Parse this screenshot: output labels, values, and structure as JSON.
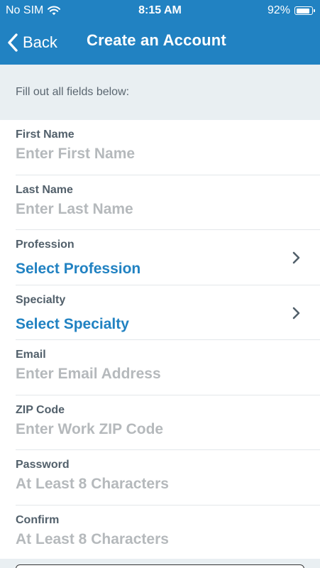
{
  "status_bar": {
    "carrier": "No SIM",
    "time": "8:15 AM",
    "battery_percent": "92%",
    "battery_level": 0.92,
    "wifi_icon": "wifi-icon",
    "battery_icon": "battery-icon"
  },
  "nav": {
    "back_label": "Back",
    "back_icon": "chevron-left-icon",
    "title": "Create an Account"
  },
  "instructions": "Fill out all fields below:",
  "fields": {
    "first_name": {
      "label": "First Name",
      "placeholder": "Enter First Name",
      "value": ""
    },
    "last_name": {
      "label": "Last Name",
      "placeholder": "Enter Last Name",
      "value": ""
    },
    "profession": {
      "label": "Profession",
      "value": "Select Profession",
      "icon": "chevron-right-icon"
    },
    "specialty": {
      "label": "Specialty",
      "value": "Select Specialty",
      "icon": "chevron-right-icon"
    },
    "email": {
      "label": "Email",
      "placeholder": "Enter Email Address",
      "value": ""
    },
    "zip_code": {
      "label": "ZIP Code",
      "placeholder": "Enter Work ZIP Code",
      "value": ""
    },
    "password": {
      "label": "Password",
      "placeholder": "At Least 8 Characters",
      "value": ""
    },
    "confirm": {
      "label": "Confirm",
      "placeholder": "At Least 8 Characters",
      "value": ""
    }
  },
  "colors": {
    "header_blue": "#2182c2",
    "accent_blue": "#2182c2",
    "section_background": "#e9eff2",
    "label_gray": "#52606b",
    "placeholder_gray": "#b5b9bc"
  }
}
